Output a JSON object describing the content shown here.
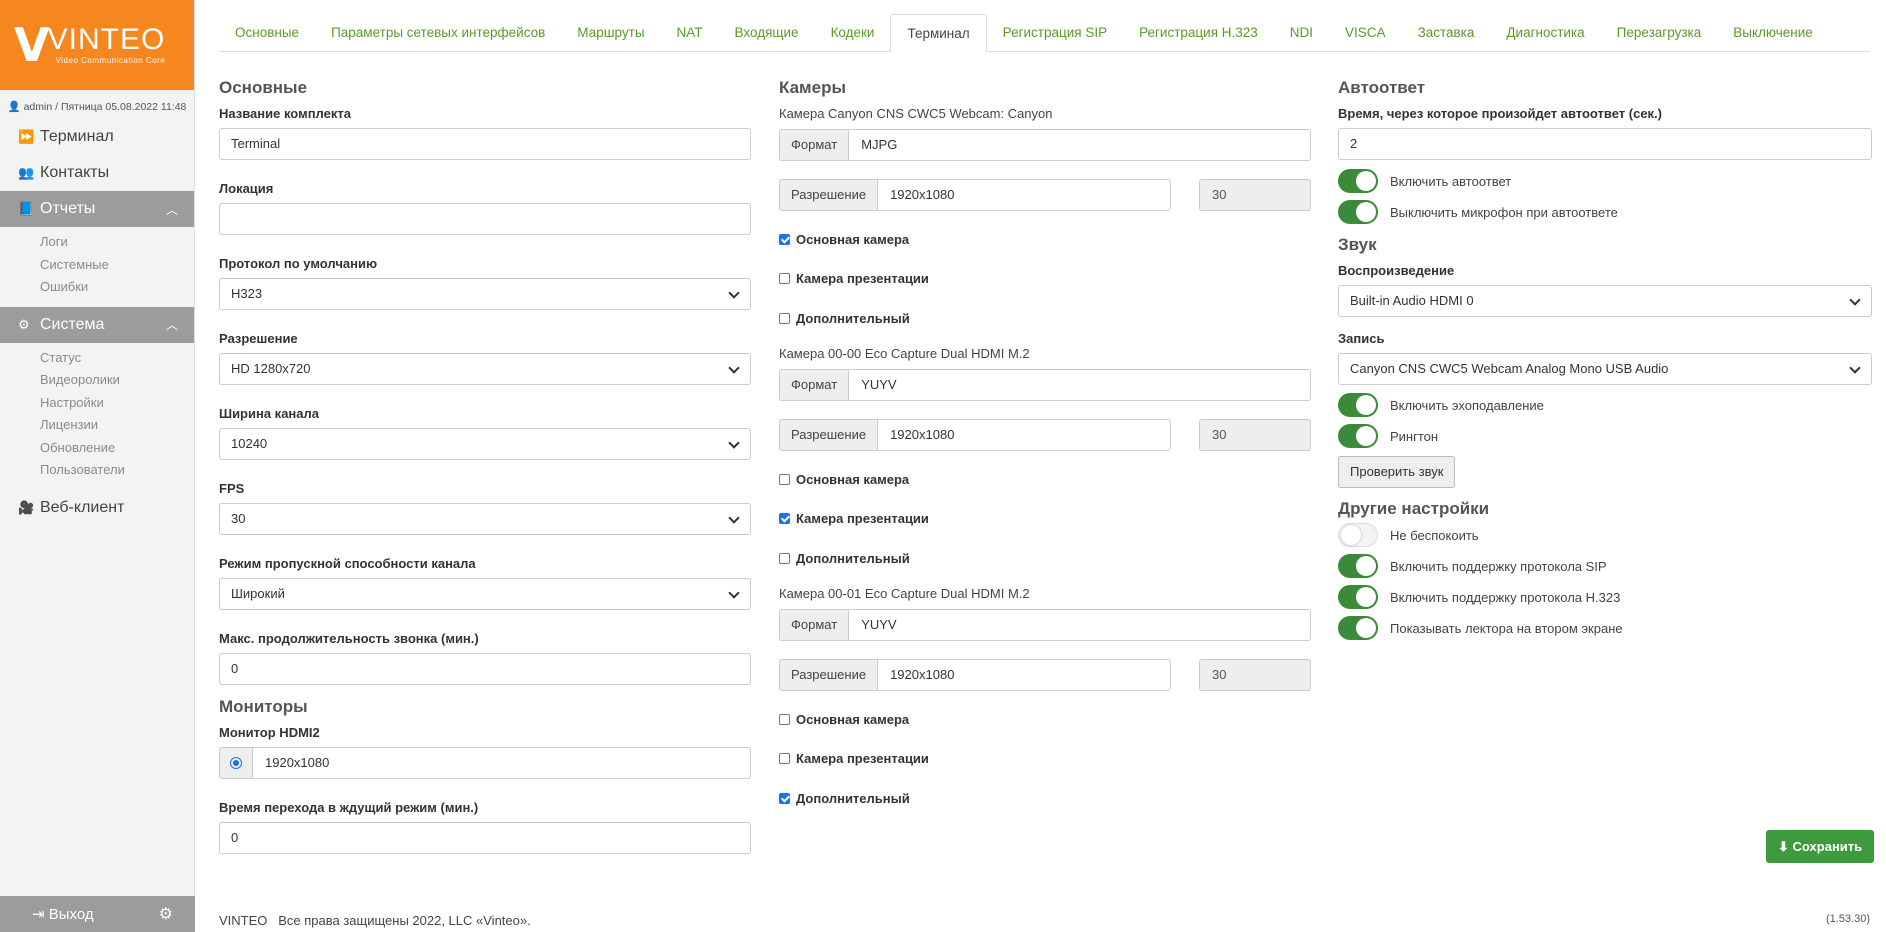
{
  "brand": {
    "logo_text": "VINTEO",
    "logo_sub": "Video Communication Core",
    "accent": "#f6871f"
  },
  "user": {
    "line": "admin / Пятница 05.08.2022 11:48"
  },
  "sidebar": {
    "items": [
      {
        "label": "Терминал",
        "icon": "forward-icon"
      },
      {
        "label": "Контакты",
        "icon": "users-icon"
      }
    ],
    "reports": {
      "label": "Отчеты",
      "icon": "book-icon",
      "sub": [
        "Логи",
        "Системные",
        "Ошибки"
      ]
    },
    "system": {
      "label": "Система",
      "icon": "cogs-icon",
      "sub": [
        "Статус",
        "Видеоролики",
        "Настройки",
        "Лицензии",
        "Обновление",
        "Пользователи"
      ]
    },
    "webclient": {
      "label": "Веб-клиент",
      "icon": "video-camera-icon"
    },
    "logout": "Выход"
  },
  "tabs": [
    "Основные",
    "Параметры сетевых интерфейсов",
    "Маршруты",
    "NAT",
    "Входящие",
    "Кодеки",
    "Терминал",
    "Регистрация SIP",
    "Регистрация H.323",
    "NDI",
    "VISCA",
    "Заставка",
    "Диагностика",
    "Перезагрузка",
    "Выключение"
  ],
  "active_tab": "Терминал",
  "basic": {
    "title": "Основные",
    "name_label": "Название комплекта",
    "name_value": "Terminal",
    "location_label": "Локация",
    "location_value": "",
    "protocol_label": "Протокол по умолчанию",
    "protocol_value": "H323",
    "resolution_label": "Разрешение",
    "resolution_value": "HD 1280x720",
    "bandwidth_label": "Ширина канала",
    "bandwidth_value": "10240",
    "fps_label": "FPS",
    "fps_value": "30",
    "mode_label": "Режим пропускной способности канала",
    "mode_value": "Широкий",
    "maxcall_label": "Макс. продолжительность звонка (мин.)",
    "maxcall_value": "0"
  },
  "monitors": {
    "title": "Мониторы",
    "hdmi_label": "Монитор HDMI2",
    "hdmi_value": "1920x1080",
    "standby_label": "Время перехода в ждущий режим (мин.)",
    "standby_value": "0"
  },
  "cameras": {
    "title": "Камеры",
    "format_label": "Формат",
    "resolution_label": "Разрешение",
    "check_main": "Основная камера",
    "check_presentation": "Камера презентации",
    "check_extra": "Дополнительный",
    "list": [
      {
        "name": "Камера Canyon CNS CWC5 Webcam: Canyon",
        "format": "MJPG",
        "resolution": "1920x1080",
        "fps": "30",
        "main": true,
        "presentation": false,
        "extra": false
      },
      {
        "name": "Камера 00-00 Eco Capture Dual HDMI M.2",
        "format": "YUYV",
        "resolution": "1920x1080",
        "fps": "30",
        "main": false,
        "presentation": true,
        "extra": false
      },
      {
        "name": "Камера 00-01 Eco Capture Dual HDMI M.2",
        "format": "YUYV",
        "resolution": "1920x1080",
        "fps": "30",
        "main": false,
        "presentation": false,
        "extra": true
      }
    ]
  },
  "autoanswer": {
    "title": "Автоответ",
    "time_label": "Время, через которое произойдет автоответ (сек.)",
    "time_value": "2",
    "enable_label": "Включить автоответ",
    "enable_on": true,
    "mute_label": "Выключить микрофон при автоответе",
    "mute_on": true
  },
  "sound": {
    "title": "Звук",
    "playback_label": "Воспроизведение",
    "playback_value": "Built-in Audio HDMI 0",
    "record_label": "Запись",
    "record_value": "Canyon CNS CWC5 Webcam Analog Mono USB Audio",
    "echo_label": "Включить эхоподавление",
    "echo_on": true,
    "ring_label": "Рингтон",
    "ring_on": true,
    "test_button": "Проверить звук"
  },
  "other": {
    "title": "Другие настройки",
    "dnd_label": "Не беспокоить",
    "dnd_on": false,
    "sip_label": "Включить поддержку протокола SIP",
    "sip_on": true,
    "h323_label": "Включить поддержку протокола H.323",
    "h323_on": true,
    "speaker_label": "Показывать лектора на втором экране",
    "speaker_on": true
  },
  "save_button": "Сохранить",
  "footer": {
    "text": "VINTEO   Все права защищены 2022, LLC «Vinteo».",
    "version": "(1.53.30)"
  }
}
